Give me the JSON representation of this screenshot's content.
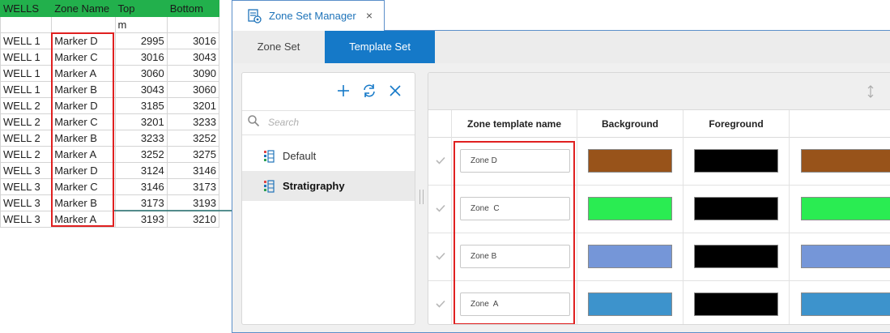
{
  "sheet": {
    "headers": [
      "WELLS",
      "Zone Name",
      "Top",
      "Bottom"
    ],
    "unit_row": [
      "",
      "",
      "m",
      ""
    ],
    "rows": [
      [
        "WELL 1",
        "Marker D",
        "2995",
        "3016"
      ],
      [
        "WELL 1",
        "Marker C",
        "3016",
        "3043"
      ],
      [
        "WELL 1",
        "Marker A",
        "3060",
        "3090"
      ],
      [
        "WELL 1",
        "Marker B",
        "3043",
        "3060"
      ],
      [
        "WELL 2",
        "Marker D",
        "3185",
        "3201"
      ],
      [
        "WELL 2",
        "Marker C",
        "3201",
        "3233"
      ],
      [
        "WELL 2",
        "Marker B",
        "3233",
        "3252"
      ],
      [
        "WELL 2",
        "Marker A",
        "3252",
        "3275"
      ],
      [
        "WELL 3",
        "Marker D",
        "3124",
        "3146"
      ],
      [
        "WELL 3",
        "Marker C",
        "3146",
        "3173"
      ],
      [
        "WELL 3",
        "Marker B",
        "3173",
        "3193"
      ],
      [
        "WELL 3",
        "Marker A",
        "3193",
        "3210"
      ]
    ],
    "header_color": "#22b04c"
  },
  "window": {
    "title": "Zone Set Manager",
    "close_glyph": "×",
    "tabs": [
      {
        "label": "Zone Set",
        "active": false
      },
      {
        "label": "Template Set",
        "active": true
      }
    ],
    "accent_color": "#1579c8"
  },
  "left_panel": {
    "toolbar_icons": [
      "plus-icon",
      "refresh-icon",
      "close-icon"
    ],
    "search_placeholder": "Search",
    "items": [
      {
        "label": "Default",
        "selected": false
      },
      {
        "label": "Stratigraphy",
        "selected": true
      }
    ]
  },
  "grid": {
    "columns": [
      "Zone template name",
      "Background",
      "Foreground",
      ""
    ],
    "rows": [
      {
        "name": "Zone D",
        "background": "#98531a",
        "foreground": "#000000",
        "extra": "#98531a"
      },
      {
        "name": "Zone  C",
        "background": "#2aec52",
        "foreground": "#000000",
        "extra": "#2aec52"
      },
      {
        "name": "Zone B",
        "background": "#7596d8",
        "foreground": "#000000",
        "extra": "#7596d8"
      },
      {
        "name": "Zone  A",
        "background": "#3d93cc",
        "foreground": "#000000",
        "extra": "#3d93cc"
      }
    ]
  },
  "annotation": {
    "highlight_color": "#e02020",
    "arrow_color": "#1f6b6b"
  }
}
